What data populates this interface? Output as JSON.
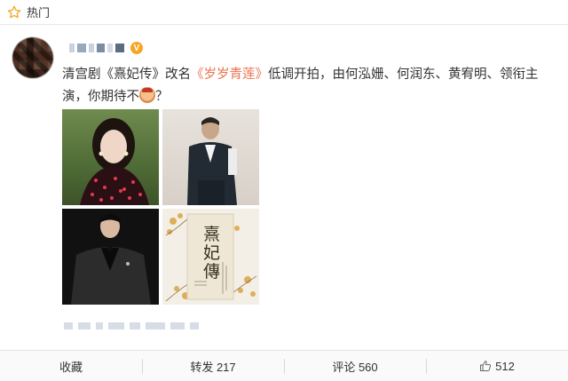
{
  "hot_bar": {
    "label": "热门",
    "icon": "star-icon"
  },
  "post": {
    "verified_badge": "V",
    "text_before": "清宫剧",
    "old_title": "《熹妃传》",
    "text_middle": "改名",
    "new_title": "《岁岁青莲》",
    "text_after": "低调开拍，由何泓姗、何润东、黄宥明、领衔主演，你期待不",
    "text_end": "？",
    "emoji_icon": "emoji-icon",
    "poster_text": "熹妃傳"
  },
  "actions": {
    "collect": "收藏",
    "repost": "转发 217",
    "comment": "评论 560",
    "like": "512"
  },
  "colors": {
    "link": "#eb7350",
    "badge": "#f5a623"
  }
}
